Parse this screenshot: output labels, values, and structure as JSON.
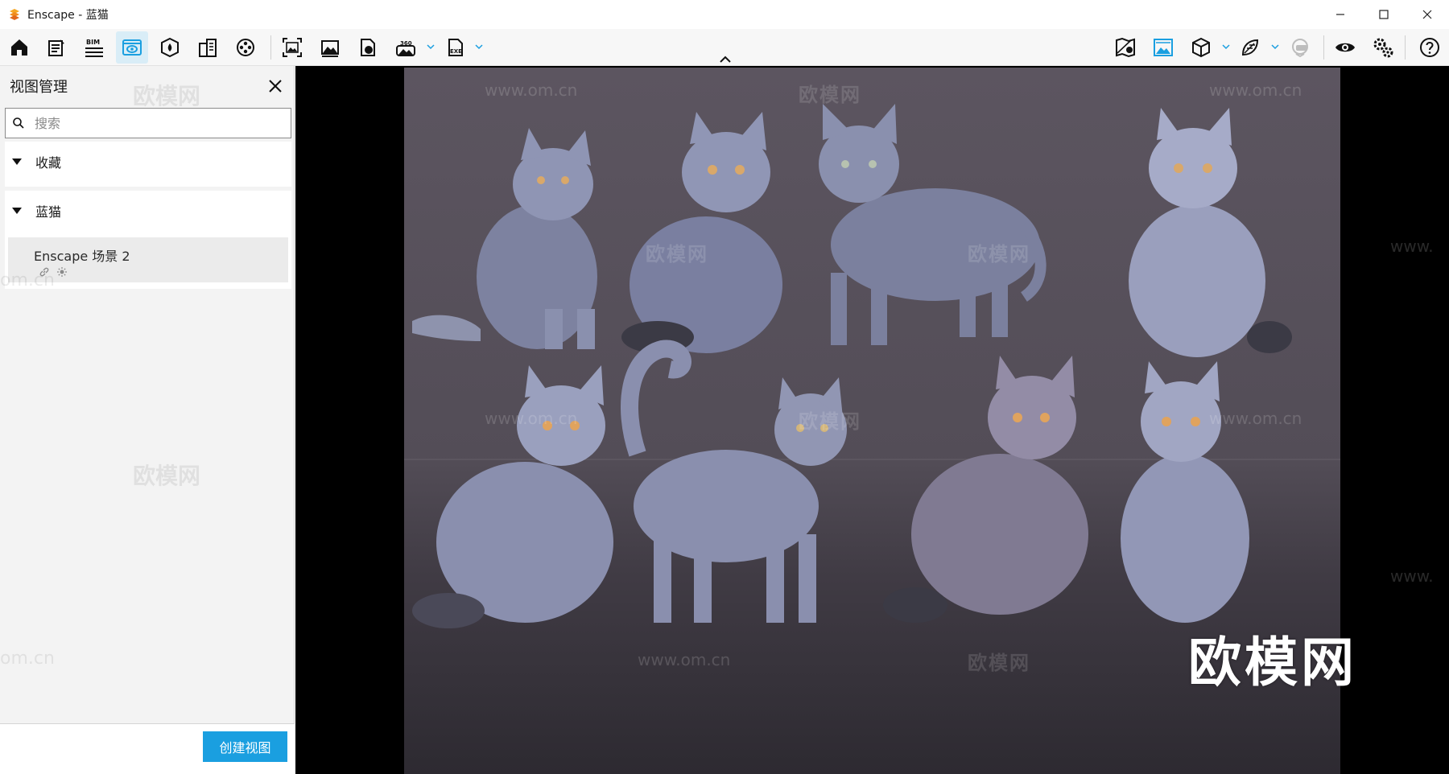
{
  "window": {
    "title": "Enscape - 蓝猫",
    "controls": [
      "minimize-icon",
      "maximize-icon",
      "close-icon"
    ]
  },
  "toolbar": {
    "left_icons": [
      "home-icon",
      "notes-icon",
      "bim-icon",
      "view-management-icon",
      "asset-library-icon",
      "buildings-icon",
      "video-editor-icon",
      "screenshot-icon",
      "batch-render-icon",
      "web-standalone-icon",
      "panorama-360-icon",
      "exe-export-icon"
    ],
    "bim_label": "BIM",
    "pano_label": "360",
    "exe_label": "EXE",
    "right_icons": [
      "map-icon",
      "image-view-icon",
      "cube-icon",
      "material-icon",
      "vr-headset-icon",
      "visual-settings-icon",
      "settings-icon",
      "help-icon"
    ],
    "active": "view-management-icon",
    "accent": "#1a9fe0"
  },
  "panel": {
    "title": "视图管理",
    "search_placeholder": "搜索",
    "sections": [
      {
        "label": "收藏",
        "expanded": true,
        "items": []
      },
      {
        "label": "蓝猫",
        "expanded": true,
        "items": [
          {
            "name": "Enscape 场景 2",
            "icons": [
              "link-icon",
              "sun-icon"
            ]
          }
        ]
      }
    ],
    "create_button": "创建视图"
  },
  "viewport": {
    "watermark_cn": "欧模网",
    "watermark_url": "www.om.cn",
    "side_url_fragment": "om.cn",
    "side_url_prefix": "www.",
    "logo": "欧模网"
  }
}
